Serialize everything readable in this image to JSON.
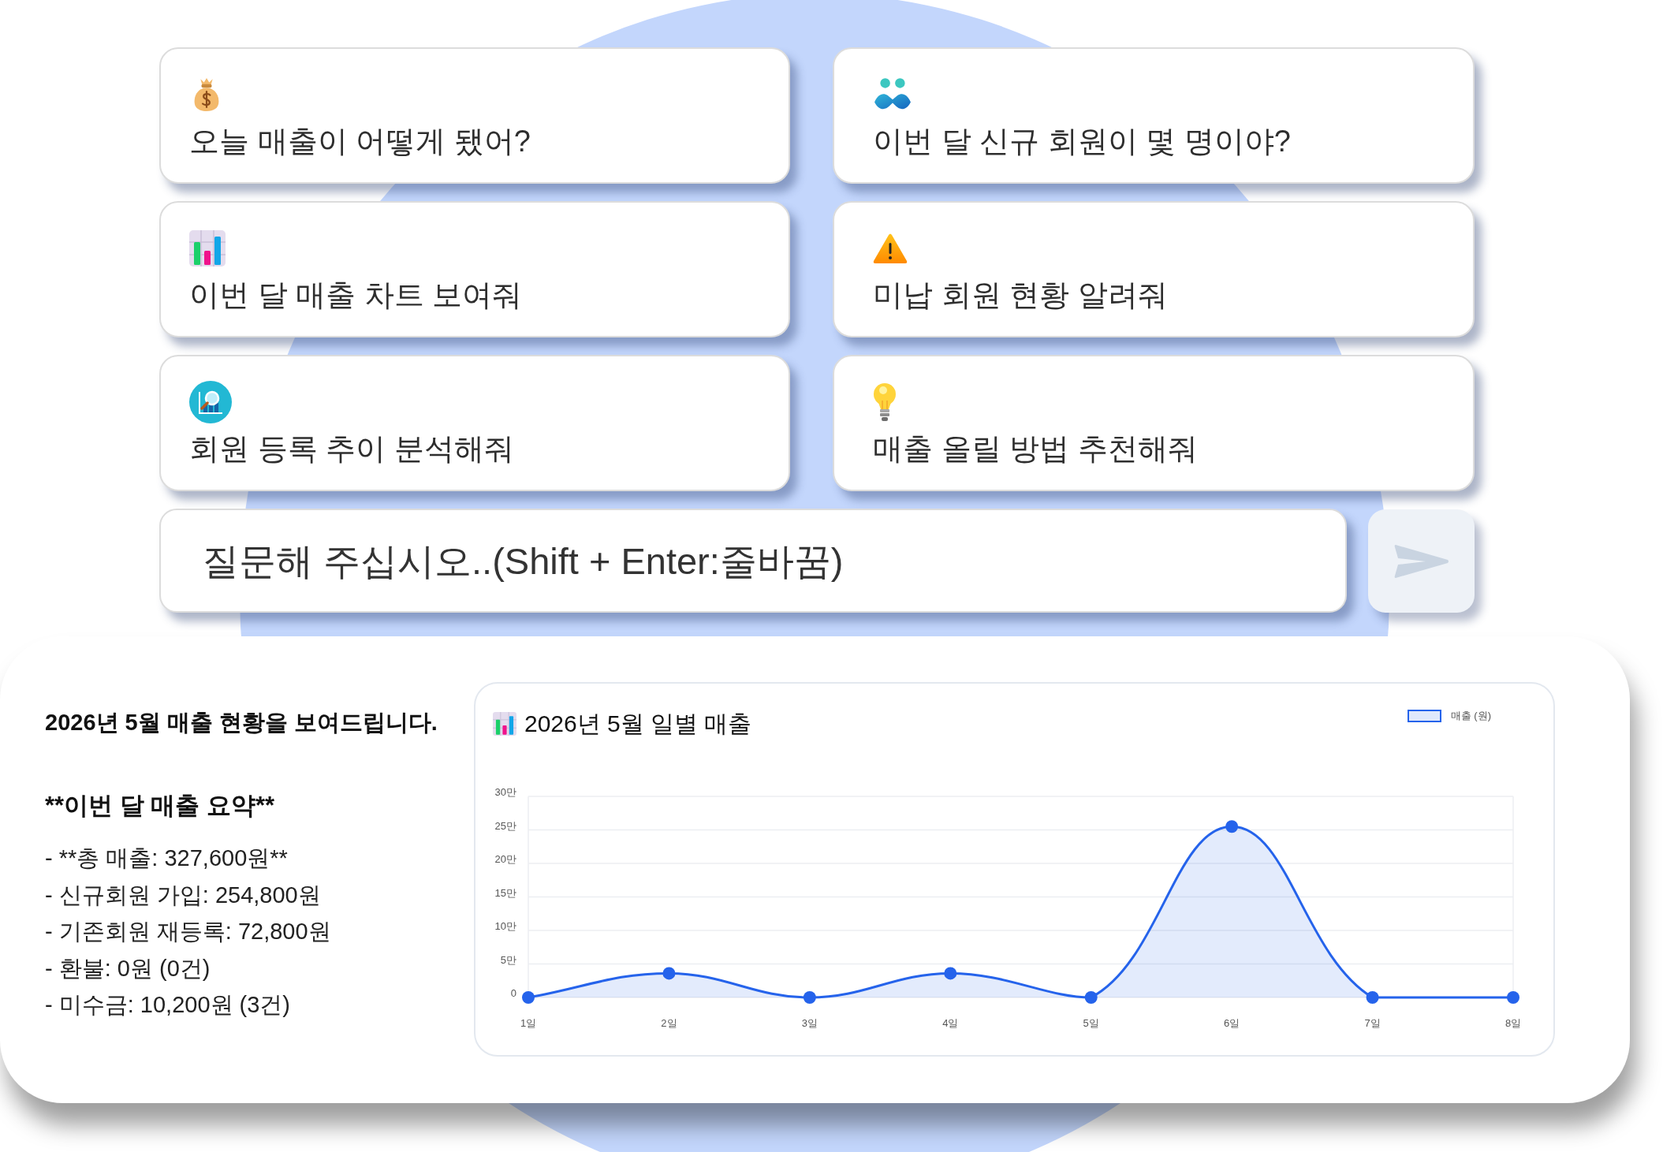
{
  "suggestions": [
    "오늘 매출이 어떻게 됐어?",
    "이번 달 신규 회원이 몇 명이야?",
    "이번 달 매출 차트 보여줘",
    "미납 회원 현황 알려줘",
    "회원 등록 추이 분석해줘",
    "매출 올릴 방법 추천해줘"
  ],
  "composer": {
    "placeholder": "질문해 주십시오..(Shift + Enter:줄바꿈)"
  },
  "response": {
    "intro": "2026년 5월 매출 현황을 보여드립니다.",
    "summary_heading": "**이번 달 매출 요약**",
    "summary_lines": [
      "- **총 매출: 327,600원**",
      "- 신규회원 가입: 254,800원",
      "- 기존회원 재등록: 72,800원",
      "- 환불: 0원 (0건)",
      "- 미수금: 10,200원 (3건)"
    ],
    "chart": {
      "chart_data": {
        "type": "area",
        "title": "2026년 5월 일별 매출",
        "categories": [
          "1일",
          "2일",
          "3일",
          "4일",
          "5일",
          "6일",
          "7일",
          "8일"
        ],
        "series": [
          {
            "name": "매출 (원)",
            "color": "#2563eb",
            "values": [
              0,
              3.6,
              0,
              3.6,
              0,
              25.5,
              0,
              0
            ]
          }
        ],
        "ylim": [
          0,
          30
        ],
        "yticks": [
          {
            "value": 0,
            "label": "0"
          },
          {
            "value": 5,
            "label": "5만"
          },
          {
            "value": 10,
            "label": "10만"
          },
          {
            "value": 15,
            "label": "15만"
          },
          {
            "value": 20,
            "label": "20만"
          },
          {
            "value": 25,
            "label": "25만"
          },
          {
            "value": 30,
            "label": "30만"
          }
        ],
        "grid": true
      }
    }
  }
}
